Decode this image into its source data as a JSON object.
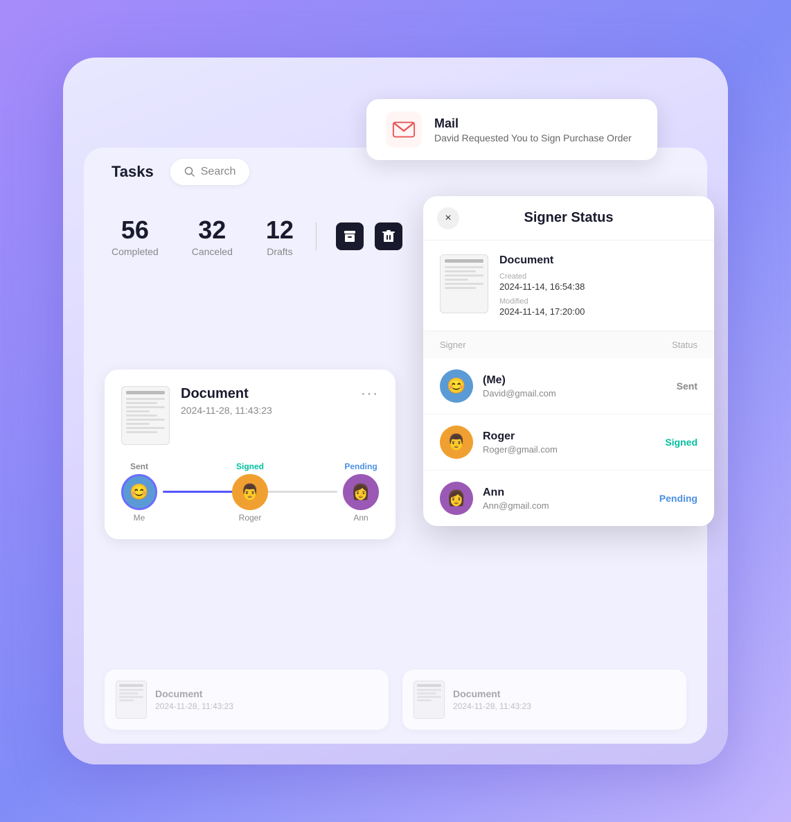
{
  "app": {
    "title": "Tasks"
  },
  "notification": {
    "title": "Mail",
    "subtitle": "David Requested You to Sign Purchase Order"
  },
  "stats": {
    "completed_count": "56",
    "completed_label": "Completed",
    "canceled_count": "32",
    "canceled_label": "Canceled",
    "drafts_count": "12",
    "drafts_label": "Drafts"
  },
  "search": {
    "placeholder": "Search"
  },
  "document_card": {
    "title": "Document",
    "date": "2024-11-28, 11:43:23",
    "signers": [
      {
        "name": "Me",
        "status": "Sent",
        "status_key": "sent"
      },
      {
        "name": "Roger",
        "status": "Signed",
        "status_key": "signed"
      },
      {
        "name": "Ann",
        "status": "Pending",
        "status_key": "pending"
      }
    ]
  },
  "signer_status_modal": {
    "title": "Signer Status",
    "close_label": "×",
    "document": {
      "title": "Document",
      "created_label": "Created",
      "created_value": "2024-11-14, 16:54:38",
      "modified_label": "Modified",
      "modified_value": "2024-11-14, 17:20:00"
    },
    "table_headers": {
      "signer": "Signer",
      "status": "Status"
    },
    "signers": [
      {
        "name": "(Me)",
        "email": "David@gmail.com",
        "status": "Sent",
        "status_key": "sent",
        "avatar_initial": "😊"
      },
      {
        "name": "Roger",
        "email": "Roger@gmail.com",
        "status": "Signed",
        "status_key": "signed",
        "avatar_initial": "👨"
      },
      {
        "name": "Ann",
        "email": "Ann@gmail.com",
        "status": "Pending",
        "status_key": "pending",
        "avatar_initial": "👩"
      }
    ]
  },
  "bottom_docs": [
    {
      "title": "Document",
      "date": "2024-11-28, 11:43:23"
    },
    {
      "title": "Document",
      "date": "2024-11-28, 11:43:23"
    }
  ]
}
